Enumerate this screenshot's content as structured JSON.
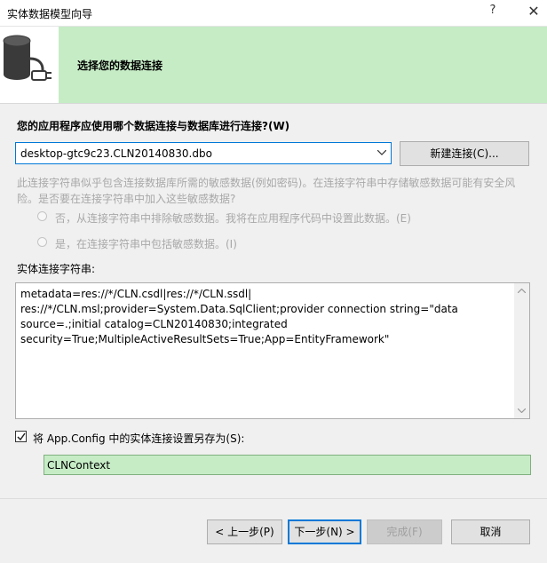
{
  "window": {
    "title": "实体数据模型向导",
    "help_glyph": "?",
    "close_glyph": "✕"
  },
  "banner": {
    "heading": "选择您的数据连接",
    "icon": "database-connection-icon",
    "background_color": "#c6ecc6"
  },
  "connection": {
    "question": "您的应用程序应使用哪个数据连接与数据库进行连接?(W)",
    "selected": "desktop-gtc9c23.CLN20140830.dbo",
    "new_connection_label": "新建连接(C)..."
  },
  "sensitive": {
    "warning": "此连接字符串似乎包含连接数据库所需的敏感数据(例如密码)。在连接字符串中存储敏感数据可能有安全风险。是否要在连接字符串中加入这些敏感数据?",
    "option_exclude": "否，从连接字符串中排除敏感数据。我将在应用程序代码中设置此数据。(E)",
    "option_include": "是，在连接字符串中包括敏感数据。(I)"
  },
  "entity_string": {
    "label": "实体连接字符串:",
    "lines": [
      "metadata=res://*/CLN.csdl|res://*/CLN.ssdl|",
      "res://*/CLN.msl;provider=System.Data.SqlClient;provider connection string=\"data",
      "source=.;initial catalog=CLN20140830;integrated",
      "security=True;MultipleActiveResultSets=True;App=EntityFramework\""
    ]
  },
  "save": {
    "checkbox_label": "将 App.Config 中的实体连接设置另存为(S):",
    "checked": true,
    "context_name": "CLNContext"
  },
  "footer": {
    "prev": "< 上一步(P)",
    "next": "下一步(N) >",
    "finish": "完成(F)",
    "cancel": "取消"
  },
  "colors": {
    "accent": "#0078d7",
    "banner_green": "#c6ecc6"
  }
}
